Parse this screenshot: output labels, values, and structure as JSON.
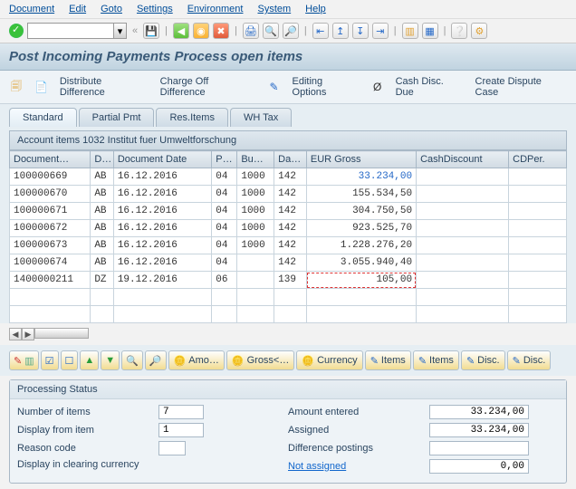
{
  "menubar": [
    "Document",
    "Edit",
    "Goto",
    "Settings",
    "Environment",
    "System",
    "Help"
  ],
  "title": "Post Incoming Payments Process open items",
  "actions": {
    "distribute": "Distribute Difference",
    "chargeoff": "Charge Off Difference",
    "editing": "Editing Options",
    "cashdisc": "Cash Disc. Due",
    "dispute": "Create Dispute Case"
  },
  "tabs": [
    "Standard",
    "Partial Pmt",
    "Res.Items",
    "WH Tax"
  ],
  "active_tab": 0,
  "group_header": "Account items 1032 Institut fuer Umweltforschung",
  "cols": [
    "Document…",
    "D…",
    "Document Date",
    "P…",
    "Bu…",
    "Da…",
    "EUR Gross",
    "CashDiscount",
    "CDPer."
  ],
  "rows": [
    {
      "doc": "100000669",
      "dt": "AB",
      "date": "16.12.2016",
      "p": "04",
      "bu": "1000",
      "da": "142",
      "gross": "33.234,00",
      "cd": "",
      "cdp": ""
    },
    {
      "doc": "100000670",
      "dt": "AB",
      "date": "16.12.2016",
      "p": "04",
      "bu": "1000",
      "da": "142",
      "gross": "155.534,50",
      "cd": "",
      "cdp": ""
    },
    {
      "doc": "100000671",
      "dt": "AB",
      "date": "16.12.2016",
      "p": "04",
      "bu": "1000",
      "da": "142",
      "gross": "304.750,50",
      "cd": "",
      "cdp": ""
    },
    {
      "doc": "100000672",
      "dt": "AB",
      "date": "16.12.2016",
      "p": "04",
      "bu": "1000",
      "da": "142",
      "gross": "923.525,70",
      "cd": "",
      "cdp": ""
    },
    {
      "doc": "100000673",
      "dt": "AB",
      "date": "16.12.2016",
      "p": "04",
      "bu": "1000",
      "da": "142",
      "gross": "1.228.276,20",
      "cd": "",
      "cdp": ""
    },
    {
      "doc": "100000674",
      "dt": "AB",
      "date": "16.12.2016",
      "p": "04",
      "bu": "",
      "da": "142",
      "gross": "3.055.940,40",
      "cd": "",
      "cdp": ""
    },
    {
      "doc": "1400000211",
      "dt": "DZ",
      "date": "19.12.2016",
      "p": "06",
      "bu": "",
      "da": "139",
      "gross": "105,00",
      "cd": "",
      "cdp": ""
    }
  ],
  "btnbar": {
    "amo": "Amo…",
    "gross": "Gross<…",
    "currency": "Currency",
    "items": "Items",
    "disc": "Disc."
  },
  "processing": {
    "title": "Processing Status",
    "num_label": "Number of items",
    "num_value": "7",
    "from_label": "Display from item",
    "from_value": "1",
    "reason_label": "Reason code",
    "reason_value": "",
    "display_curr": "Display in clearing currency",
    "amt_entered_label": "Amount entered",
    "amt_entered_value": "33.234,00",
    "assigned_label": "Assigned",
    "assigned_value": "33.234,00",
    "diff_label": "Difference postings",
    "diff_value": "",
    "not_assigned_label": "Not assigned",
    "not_assigned_value": "0,00"
  }
}
